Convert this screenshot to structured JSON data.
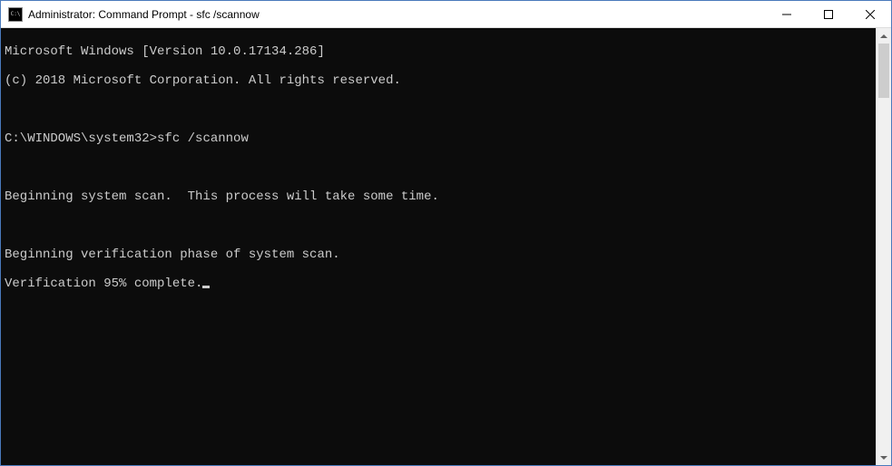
{
  "window": {
    "title": "Administrator: Command Prompt - sfc  /scannow"
  },
  "terminal": {
    "header_line_1": "Microsoft Windows [Version 10.0.17134.286]",
    "header_line_2": "(c) 2018 Microsoft Corporation. All rights reserved.",
    "prompt_path": "C:\\WINDOWS\\system32>",
    "command": "sfc /scannow",
    "msg_begin_scan": "Beginning system scan.  This process will take some time.",
    "msg_begin_verify": "Beginning verification phase of system scan.",
    "msg_progress": "Verification 95% complete."
  }
}
